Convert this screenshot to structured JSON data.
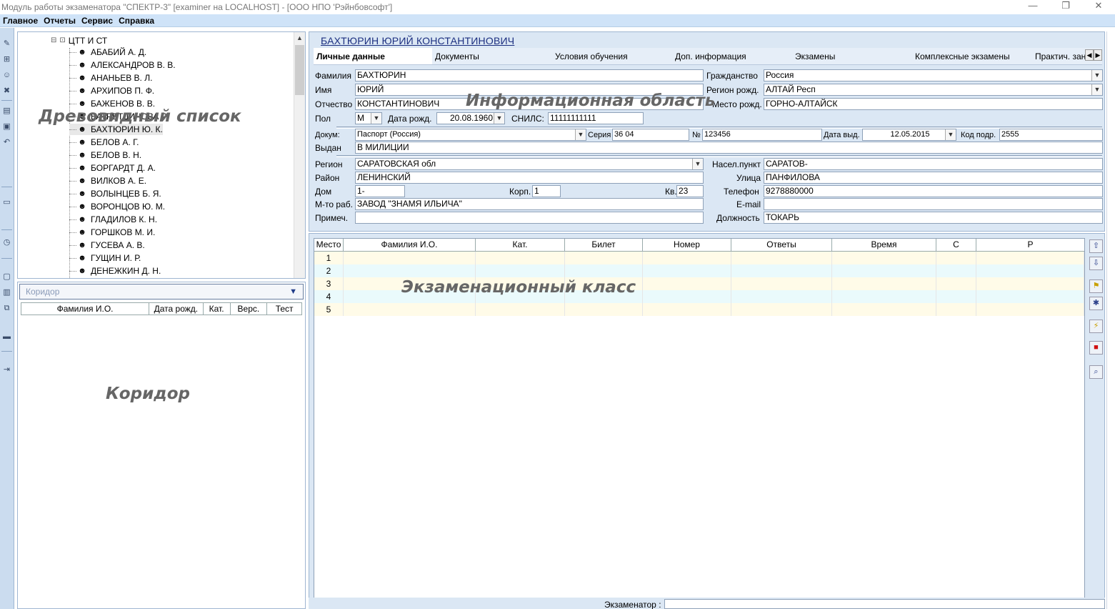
{
  "window": {
    "title": "Модуль работы экзаменатора \"СПЕКТР-3\" [examiner на LOCALHOST] - [ООО НПО 'Рэйнбовсофт']",
    "minimize": "—",
    "restore": "❐",
    "close": "✕"
  },
  "menu": [
    "Главное",
    "Отчеты",
    "Сервис",
    "Справка"
  ],
  "tree": {
    "root": "ЦТТ И СТ",
    "items": [
      "АБАБИЙ А. Д.",
      "АЛЕКСАНДРОВ В. В.",
      "АНАНЬЕВ В. Л.",
      "АРХИПОВ П. Ф.",
      "БАЖЕНОВ В. В.",
      "БАТРЕТДИНОВА Р.",
      "БАХТЮРИН Ю. К.",
      "БЕЛОВ А. Г.",
      "БЕЛОВ В. Н.",
      "БОРГАРДТ Д. А.",
      "ВИЛКОВ А. Е.",
      "ВОЛЫНЦЕВ Б. Я.",
      "ВОРОНЦОВ Ю. М.",
      "ГЛАДИЛОВ К. Н.",
      "ГОРШКОВ М. И.",
      "ГУСЕВА А. В.",
      "ГУЩИН И. Р.",
      "ДЕНЕЖКИН Д. Н."
    ],
    "overlay": "Древовидный список"
  },
  "corridor": {
    "header": "Коридор",
    "columns": [
      "Фамилия И.О.",
      "Дата рожд.",
      "Кат.",
      "Верс.",
      "Тест"
    ],
    "overlay": "Коридор"
  },
  "info": {
    "student_name": "БАХТЮРИН ЮРИЙ КОНСТАНТИНОВИЧ",
    "overlay": "Информационная область",
    "tabs": [
      "Личные данные",
      "Документы",
      "Условия обучения",
      "Доп. информация",
      "Экзамены",
      "Комплексные экзамены",
      "Практич. зан"
    ],
    "labels": {
      "surname": "Фамилия",
      "name": "Имя",
      "patronymic": "Отчество",
      "sex": "Пол",
      "birth_date": "Дата рожд.",
      "snils": "СНИЛС:",
      "citizenship": "Гражданство",
      "birth_region": "Регион рожд.",
      "birth_place": "Место рожд.",
      "doc": "Докум:",
      "series": "Серия",
      "number": "№",
      "issue_date": "Дата выд.",
      "dept_code": "Код подр.",
      "issued_by": "Выдан",
      "region": "Регион",
      "district": "Район",
      "house": "Дом",
      "building": "Корп.",
      "flat": "Кв.",
      "work_place": "М-то раб.",
      "note": "Примеч.",
      "settlement": "Насел.пункт",
      "street": "Улица",
      "phone": "Телефон",
      "email": "E-mail",
      "position": "Должность"
    },
    "values": {
      "surname": "БАХТЮРИН",
      "name": "ЮРИЙ",
      "patronymic": "КОНСТАНТИНОВИЧ",
      "sex": "М",
      "birth_date": "20.08.1960",
      "snils": "11111111111",
      "citizenship": "Россия",
      "birth_region": "АЛТАЙ Респ",
      "birth_place": "ГОРНО-АЛТАЙСК",
      "doc": "Паспорт (Россия)",
      "series": "36 04",
      "number": "123456",
      "issue_date": "12.05.2015",
      "dept_code": "2555",
      "issued_by": "В МИЛИЦИИ",
      "region": "САРАТОВСКАЯ обл",
      "district": "ЛЕНИНСКИЙ",
      "house": "1-",
      "building": "1",
      "flat": "23",
      "work_place": "ЗАВОД \"ЗНАМЯ ИЛЬИЧА\"",
      "note": "",
      "settlement": "САРАТОВ-",
      "street": "ПАНФИЛОВА",
      "phone": "9278880000",
      "email": "",
      "position": "ТОКАРЬ"
    }
  },
  "exam": {
    "overlay": "Экзаменационный класс",
    "columns": [
      "Место",
      "Фамилия И.О.",
      "Кат.",
      "Билет",
      "Номер",
      "Ответы",
      "Время",
      "С",
      "Р"
    ],
    "rows": [
      "1",
      "2",
      "3",
      "4",
      "5"
    ]
  },
  "status": {
    "examiner_label": "Экзаменатор :"
  }
}
